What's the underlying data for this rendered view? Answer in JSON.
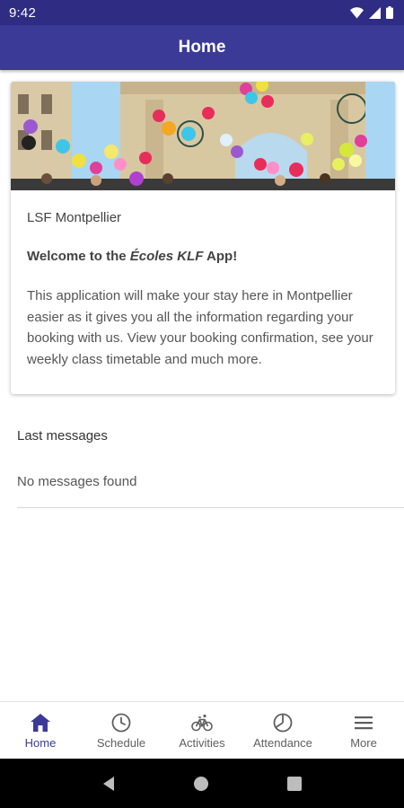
{
  "status_bar": {
    "time": "9:42",
    "icons": [
      "wifi-icon",
      "signal-icon",
      "battery-icon"
    ]
  },
  "app_bar": {
    "title": "Home"
  },
  "card": {
    "hero_image": "balloons-arch-photo",
    "school_name": "LSF Montpellier",
    "welcome_prefix": "Welcome to the ",
    "welcome_brand": "Écoles KLF",
    "welcome_suffix": " App!",
    "description": "This application will make your stay here in Montpellier easier as it gives you all the information regarding your booking with us. View your booking confirmation, see your weekly class timetable and much more."
  },
  "messages": {
    "title": "Last messages",
    "empty_text": "No messages found"
  },
  "bottom_nav": {
    "items": [
      {
        "label": "Home",
        "icon": "home-icon",
        "active": true
      },
      {
        "label": "Schedule",
        "icon": "clock-icon",
        "active": false
      },
      {
        "label": "Activities",
        "icon": "bicycle-icon",
        "active": false
      },
      {
        "label": "Attendance",
        "icon": "pie-chart-icon",
        "active": false
      },
      {
        "label": "More",
        "icon": "menu-icon",
        "active": false
      }
    ]
  },
  "colors": {
    "primary": "#3b3a96",
    "status_bar": "#2f2c84",
    "inactive": "#5e5e5e"
  }
}
